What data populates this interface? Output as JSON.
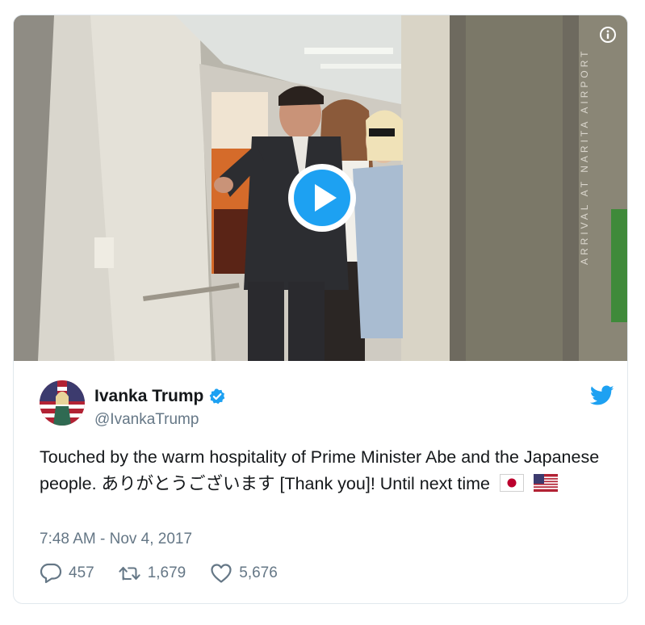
{
  "media": {
    "overlay_text": "ARRIVAL AT NARITA AIRPORT",
    "info_icon": "info-icon",
    "play_icon": "play-icon"
  },
  "tweet": {
    "display_name": "Ivanka Trump",
    "handle": "@IvankaTrump",
    "verified": true,
    "text": "Touched by the warm hospitality of Prime Minister Abe and the Japanese people. ありがとうございます [Thank you]! Until next time",
    "emoji": [
      "japan-flag",
      "us-flag"
    ],
    "timestamp": "7:48 AM - Nov 4, 2017",
    "replies": "457",
    "retweets": "1,679",
    "likes": "5,676"
  },
  "colors": {
    "brand_blue": "#1da1f2",
    "secondary_text": "#657786",
    "border": "#e1e8ed"
  }
}
